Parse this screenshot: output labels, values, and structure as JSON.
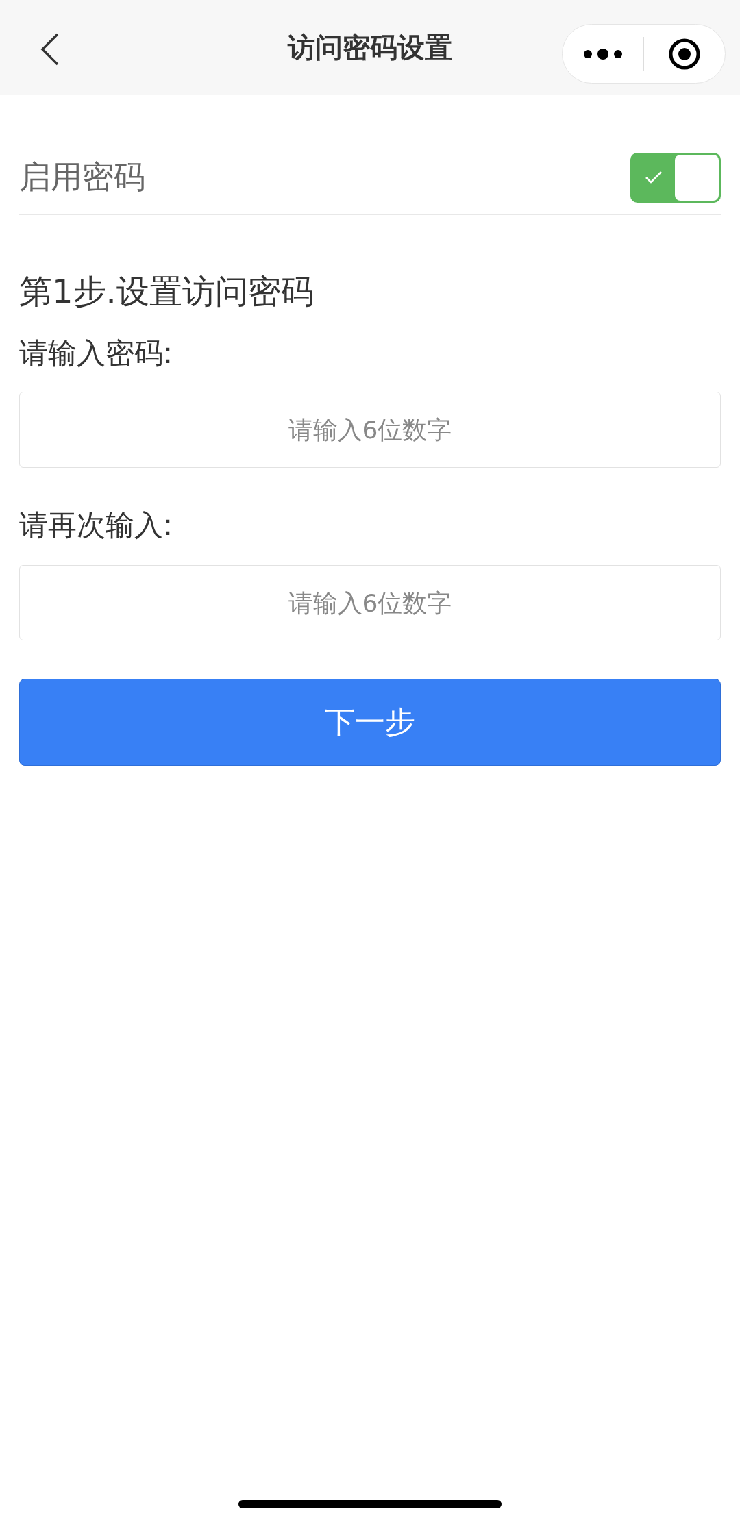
{
  "nav_bar": {
    "title": "访问密码设置"
  },
  "password_toggle": {
    "label": "启用密码",
    "on": true
  },
  "step_title": "第1步.设置访问密码",
  "fields": [
    {
      "label": "请输入密码:",
      "placeholder": "请输入6位数字"
    },
    {
      "label": "请再次输入:",
      "placeholder": "请输入6位数字"
    }
  ],
  "next_button": "下一步"
}
